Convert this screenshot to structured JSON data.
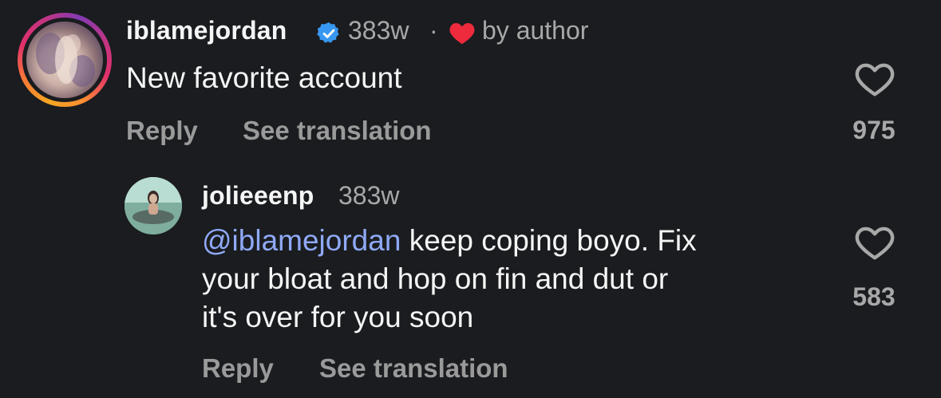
{
  "comments": [
    {
      "username": "iblamejordan",
      "verified": true,
      "time": "383w",
      "separator": "·",
      "liked_by_author_label": "by author",
      "text": "New favorite account",
      "reply_label": "Reply",
      "translate_label": "See translation",
      "likes": "975",
      "story_ring": true
    },
    {
      "username": "jolieeenp",
      "time": "383w",
      "mention": "@iblamejordan",
      "text_line1": " keep coping boyo. Fix",
      "text_line2": "your bloat and hop on fin and dut or",
      "text_line3": "it's over for you soon",
      "reply_label": "Reply",
      "translate_label": "See translation",
      "likes": "583"
    }
  ],
  "colors": {
    "background": "#1a1c1f",
    "mention": "#8fa9f7",
    "verified_badge": "#3897f0",
    "author_heart": "#ed2b3d",
    "muted_text": "#a8a8a8"
  },
  "icons": {
    "verified": "verified-badge-icon",
    "author_heart": "heart-filled-icon",
    "like": "heart-outline-icon"
  }
}
